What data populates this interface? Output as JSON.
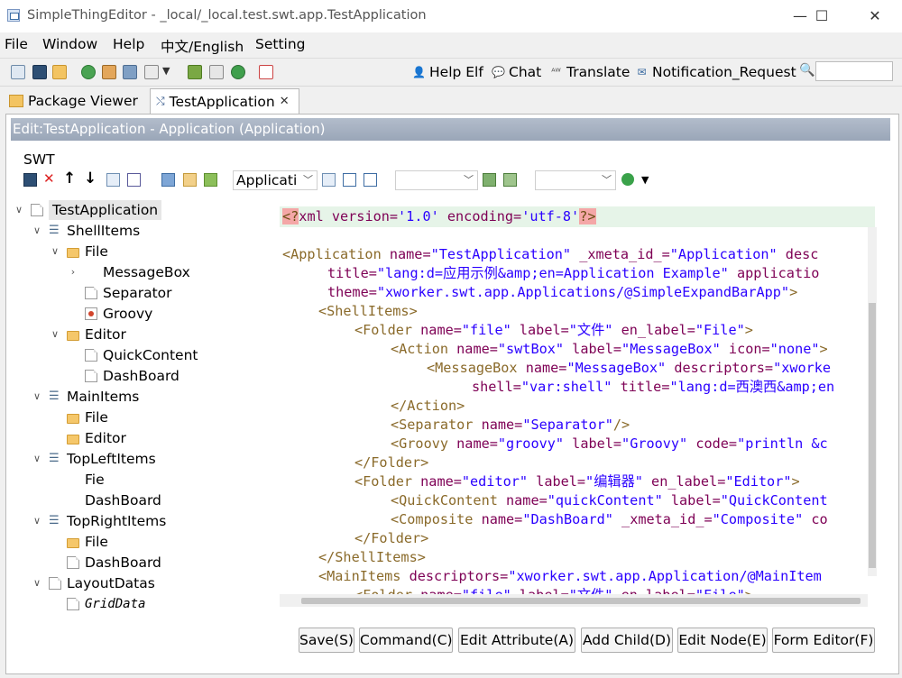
{
  "window": {
    "title": "SimpleThingEditor - _local/_local.test.swt.app.TestApplication",
    "min": "—",
    "max": "☐",
    "close": "✕"
  },
  "menu": [
    "File",
    "Window",
    "Help",
    "中文/English",
    "Setting"
  ],
  "toolbar": {
    "help": "Help Elf",
    "chat": "Chat",
    "translate": "Translate",
    "notification": "Notification_Request",
    "search_value": ""
  },
  "tabs": {
    "package": "Package Viewer",
    "app": "TestApplication"
  },
  "editor": {
    "header": "Edit:TestApplication - Application  (Application)",
    "swt": "SWT",
    "combo1": "Applicati",
    "combo2": "",
    "combo3": ""
  },
  "tree": [
    "TestApplication",
    "ShellItems",
    "File",
    "MessageBox",
    "Separator",
    "Groovy",
    "Editor",
    "QuickContent",
    "DashBoard",
    "MainItems",
    "File",
    "Editor",
    "TopLeftItems",
    "Fie",
    "DashBoard",
    "TopRightItems",
    "File",
    "DashBoard",
    "LayoutDatas",
    "GridData"
  ],
  "code": {
    "l0": [
      "<?",
      "xml",
      " version=",
      "'1.0'",
      " encoding=",
      "'utf-8'",
      "?>"
    ],
    "l1": [
      "<Application ",
      "name=",
      "\"TestApplication\"",
      " _xmeta_id_=",
      "\"Application\"",
      " desc"
    ],
    "l2": [
      "title=",
      "\"lang:d=应用示例&amp;en=Application Example\"",
      " applicatio"
    ],
    "l3": [
      "theme=",
      "\"xworker.swt.app.Applications/@SimpleExpandBarApp\"",
      ">"
    ],
    "l4": [
      "<ShellItems>"
    ],
    "l5": [
      "<Folder ",
      "name=",
      "\"file\"",
      " label=",
      "\"文件\"",
      " en_label=",
      "\"File\"",
      ">"
    ],
    "l6": [
      "<Action ",
      "name=",
      "\"swtBox\"",
      " label=",
      "\"MessageBox\"",
      " icon=",
      "\"none\"",
      ">"
    ],
    "l7": [
      "<MessageBox ",
      "name=",
      "\"MessageBox\"",
      " descriptors=",
      "\"xworke"
    ],
    "l8": [
      "shell=",
      "\"var:shell\"",
      " title=",
      "\"lang:d=西澳西&amp;en"
    ],
    "l9": [
      "</Action>"
    ],
    "l10": [
      "<Separator ",
      "name=",
      "\"Separator\"",
      "/>"
    ],
    "l11": [
      "<Groovy ",
      "name=",
      "\"groovy\"",
      " label=",
      "\"Groovy\"",
      " code=",
      "\"println &c"
    ],
    "l12": [
      "</Folder>"
    ],
    "l13": [
      "<Folder ",
      "name=",
      "\"editor\"",
      " label=",
      "\"编辑器\"",
      " en_label=",
      "\"Editor\"",
      ">"
    ],
    "l14": [
      "<QuickContent ",
      "name=",
      "\"quickContent\"",
      " label=",
      "\"QuickContent"
    ],
    "l15": [
      "<Composite ",
      "name=",
      "\"DashBoard\"",
      " _xmeta_id_=",
      "\"Composite\"",
      " co"
    ],
    "l16": [
      "</Folder>"
    ],
    "l17": [
      "</ShellItems>"
    ],
    "l18": [
      "<MainItems ",
      "descriptors=",
      "\"xworker.swt.app.Application/@MainItem"
    ],
    "l19": [
      "<Folder ",
      "name=",
      "\"file\"",
      " label=",
      "\"文件\"",
      " en_label=",
      "\"File\"",
      ">"
    ]
  },
  "buttons": {
    "save": "Save(S)",
    "command": "Command(C)",
    "edit_attr": "Edit Attribute(A)",
    "add_child": "Add Child(D)",
    "edit_node": "Edit Node(E)",
    "form_editor": "Form Editor(F)"
  }
}
